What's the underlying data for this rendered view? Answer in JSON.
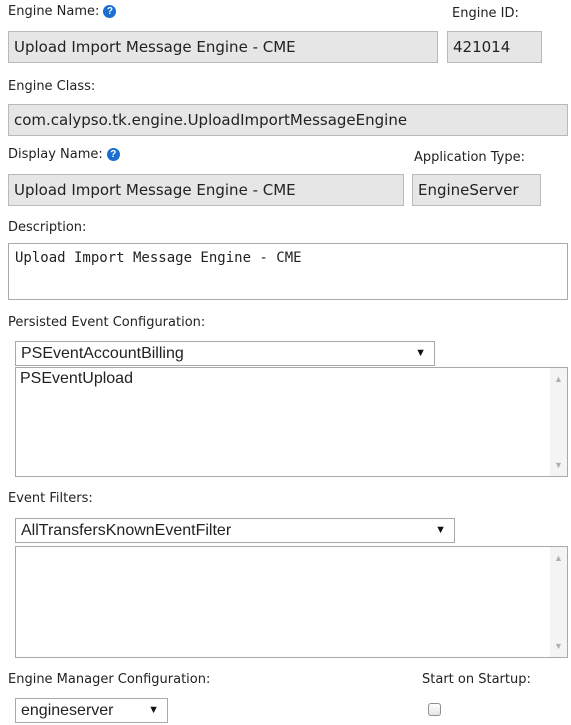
{
  "engine_name": {
    "label": "Engine Name:",
    "value": "Upload Import Message Engine - CME"
  },
  "engine_id": {
    "label": "Engine ID:",
    "value": "421014"
  },
  "engine_class": {
    "label": "Engine Class:",
    "value": "com.calypso.tk.engine.UploadImportMessageEngine"
  },
  "display_name": {
    "label": "Display Name:",
    "value": "Upload Import Message Engine - CME"
  },
  "application_type": {
    "label": "Application Type:",
    "value": "EngineServer"
  },
  "description": {
    "label": "Description:",
    "value": "Upload Import Message Engine - CME"
  },
  "persisted_event_configuration": {
    "label": "Persisted Event Configuration:",
    "selected": "PSEventAccountBilling",
    "list_items": [
      "PSEventUpload"
    ]
  },
  "event_filters": {
    "label": "Event Filters:",
    "selected": "AllTransfersKnownEventFilter",
    "list_items": []
  },
  "engine_manager_configuration": {
    "label": "Engine Manager Configuration:",
    "selected": "engineserver"
  },
  "start_on_startup": {
    "label": "Start on Startup:",
    "checked": false
  },
  "icons": {
    "help": "help-circle-icon",
    "dropdown": "dropdown-arrow-icon",
    "scroll_up": "scroll-up-icon",
    "scroll_down": "scroll-down-icon"
  },
  "colors": {
    "help_icon": "#1a6fd1",
    "readonly_bg": "#e6e6e6"
  }
}
